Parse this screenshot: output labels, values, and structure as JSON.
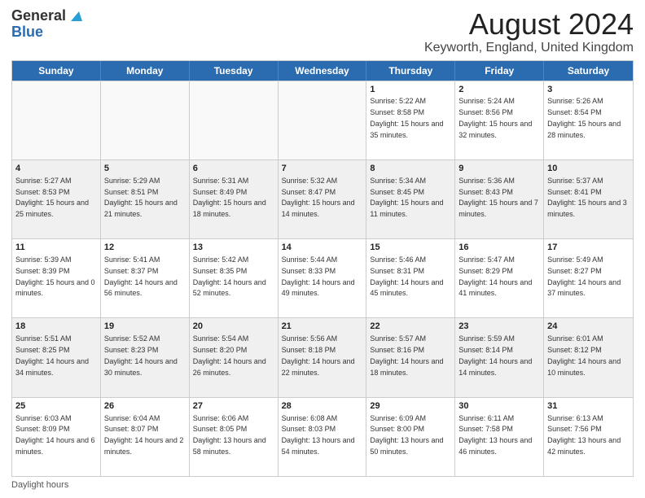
{
  "logo": {
    "general": "General",
    "blue": "Blue"
  },
  "title": "August 2024",
  "subtitle": "Keyworth, England, United Kingdom",
  "weekdays": [
    "Sunday",
    "Monday",
    "Tuesday",
    "Wednesday",
    "Thursday",
    "Friday",
    "Saturday"
  ],
  "weeks": [
    [
      {
        "day": "",
        "info": "",
        "empty": true
      },
      {
        "day": "",
        "info": "",
        "empty": true
      },
      {
        "day": "",
        "info": "",
        "empty": true
      },
      {
        "day": "",
        "info": "",
        "empty": true
      },
      {
        "day": "1",
        "info": "Sunrise: 5:22 AM\nSunset: 8:58 PM\nDaylight: 15 hours and 35 minutes."
      },
      {
        "day": "2",
        "info": "Sunrise: 5:24 AM\nSunset: 8:56 PM\nDaylight: 15 hours and 32 minutes."
      },
      {
        "day": "3",
        "info": "Sunrise: 5:26 AM\nSunset: 8:54 PM\nDaylight: 15 hours and 28 minutes."
      }
    ],
    [
      {
        "day": "4",
        "info": "Sunrise: 5:27 AM\nSunset: 8:53 PM\nDaylight: 15 hours and 25 minutes."
      },
      {
        "day": "5",
        "info": "Sunrise: 5:29 AM\nSunset: 8:51 PM\nDaylight: 15 hours and 21 minutes."
      },
      {
        "day": "6",
        "info": "Sunrise: 5:31 AM\nSunset: 8:49 PM\nDaylight: 15 hours and 18 minutes."
      },
      {
        "day": "7",
        "info": "Sunrise: 5:32 AM\nSunset: 8:47 PM\nDaylight: 15 hours and 14 minutes."
      },
      {
        "day": "8",
        "info": "Sunrise: 5:34 AM\nSunset: 8:45 PM\nDaylight: 15 hours and 11 minutes."
      },
      {
        "day": "9",
        "info": "Sunrise: 5:36 AM\nSunset: 8:43 PM\nDaylight: 15 hours and 7 minutes."
      },
      {
        "day": "10",
        "info": "Sunrise: 5:37 AM\nSunset: 8:41 PM\nDaylight: 15 hours and 3 minutes."
      }
    ],
    [
      {
        "day": "11",
        "info": "Sunrise: 5:39 AM\nSunset: 8:39 PM\nDaylight: 15 hours and 0 minutes."
      },
      {
        "day": "12",
        "info": "Sunrise: 5:41 AM\nSunset: 8:37 PM\nDaylight: 14 hours and 56 minutes."
      },
      {
        "day": "13",
        "info": "Sunrise: 5:42 AM\nSunset: 8:35 PM\nDaylight: 14 hours and 52 minutes."
      },
      {
        "day": "14",
        "info": "Sunrise: 5:44 AM\nSunset: 8:33 PM\nDaylight: 14 hours and 49 minutes."
      },
      {
        "day": "15",
        "info": "Sunrise: 5:46 AM\nSunset: 8:31 PM\nDaylight: 14 hours and 45 minutes."
      },
      {
        "day": "16",
        "info": "Sunrise: 5:47 AM\nSunset: 8:29 PM\nDaylight: 14 hours and 41 minutes."
      },
      {
        "day": "17",
        "info": "Sunrise: 5:49 AM\nSunset: 8:27 PM\nDaylight: 14 hours and 37 minutes."
      }
    ],
    [
      {
        "day": "18",
        "info": "Sunrise: 5:51 AM\nSunset: 8:25 PM\nDaylight: 14 hours and 34 minutes."
      },
      {
        "day": "19",
        "info": "Sunrise: 5:52 AM\nSunset: 8:23 PM\nDaylight: 14 hours and 30 minutes."
      },
      {
        "day": "20",
        "info": "Sunrise: 5:54 AM\nSunset: 8:20 PM\nDaylight: 14 hours and 26 minutes."
      },
      {
        "day": "21",
        "info": "Sunrise: 5:56 AM\nSunset: 8:18 PM\nDaylight: 14 hours and 22 minutes."
      },
      {
        "day": "22",
        "info": "Sunrise: 5:57 AM\nSunset: 8:16 PM\nDaylight: 14 hours and 18 minutes."
      },
      {
        "day": "23",
        "info": "Sunrise: 5:59 AM\nSunset: 8:14 PM\nDaylight: 14 hours and 14 minutes."
      },
      {
        "day": "24",
        "info": "Sunrise: 6:01 AM\nSunset: 8:12 PM\nDaylight: 14 hours and 10 minutes."
      }
    ],
    [
      {
        "day": "25",
        "info": "Sunrise: 6:03 AM\nSunset: 8:09 PM\nDaylight: 14 hours and 6 minutes."
      },
      {
        "day": "26",
        "info": "Sunrise: 6:04 AM\nSunset: 8:07 PM\nDaylight: 14 hours and 2 minutes."
      },
      {
        "day": "27",
        "info": "Sunrise: 6:06 AM\nSunset: 8:05 PM\nDaylight: 13 hours and 58 minutes."
      },
      {
        "day": "28",
        "info": "Sunrise: 6:08 AM\nSunset: 8:03 PM\nDaylight: 13 hours and 54 minutes."
      },
      {
        "day": "29",
        "info": "Sunrise: 6:09 AM\nSunset: 8:00 PM\nDaylight: 13 hours and 50 minutes."
      },
      {
        "day": "30",
        "info": "Sunrise: 6:11 AM\nSunset: 7:58 PM\nDaylight: 13 hours and 46 minutes."
      },
      {
        "day": "31",
        "info": "Sunrise: 6:13 AM\nSunset: 7:56 PM\nDaylight: 13 hours and 42 minutes."
      }
    ]
  ],
  "footer": "Daylight hours"
}
